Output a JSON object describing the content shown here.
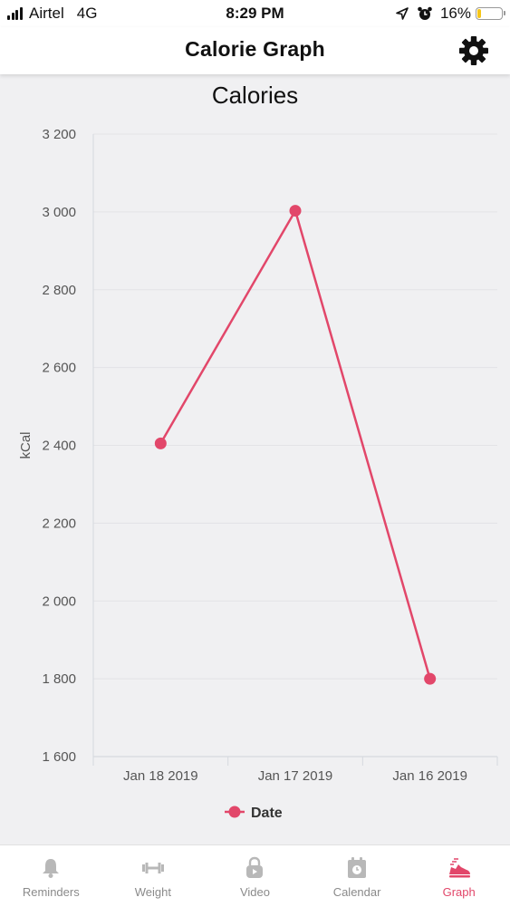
{
  "status_bar": {
    "carrier": "Airtel",
    "network": "4G",
    "time": "8:29 PM",
    "battery_text": "16%",
    "battery_level": 0.16,
    "icons": [
      "signal-icon",
      "location-arrow-icon",
      "alarm-clock-icon",
      "battery-icon"
    ]
  },
  "header": {
    "title": "Calorie Graph",
    "settings_icon": "gear-icon"
  },
  "chart_data": {
    "type": "line",
    "title": "Calories",
    "ylabel": "kCal",
    "xlabel": "",
    "categories": [
      "Jan 18 2019",
      "Jan 17 2019",
      "Jan 16 2019"
    ],
    "series": [
      {
        "name": "Date",
        "values": [
          2405,
          3003,
          1800
        ],
        "color": "#e2476a"
      }
    ],
    "ylim": [
      1600,
      3200
    ],
    "yticks": [
      "1 600",
      "1 800",
      "2 000",
      "2 200",
      "2 400",
      "2 600",
      "2 800",
      "3 000",
      "3 200"
    ],
    "grid": true,
    "legend_position": "bottom-center"
  },
  "tabs": [
    {
      "label": "Reminders",
      "icon": "bell-icon",
      "active": false
    },
    {
      "label": "Weight",
      "icon": "dumbbell-icon",
      "active": false
    },
    {
      "label": "Video",
      "icon": "video-lock-icon",
      "active": false
    },
    {
      "label": "Calendar",
      "icon": "calendar-icon",
      "active": false
    },
    {
      "label": "Graph",
      "icon": "running-shoe-icon",
      "active": true
    }
  ],
  "colors": {
    "accent": "#e2476a",
    "inactive": "#8a8a8a",
    "background": "#f0f0f2"
  }
}
